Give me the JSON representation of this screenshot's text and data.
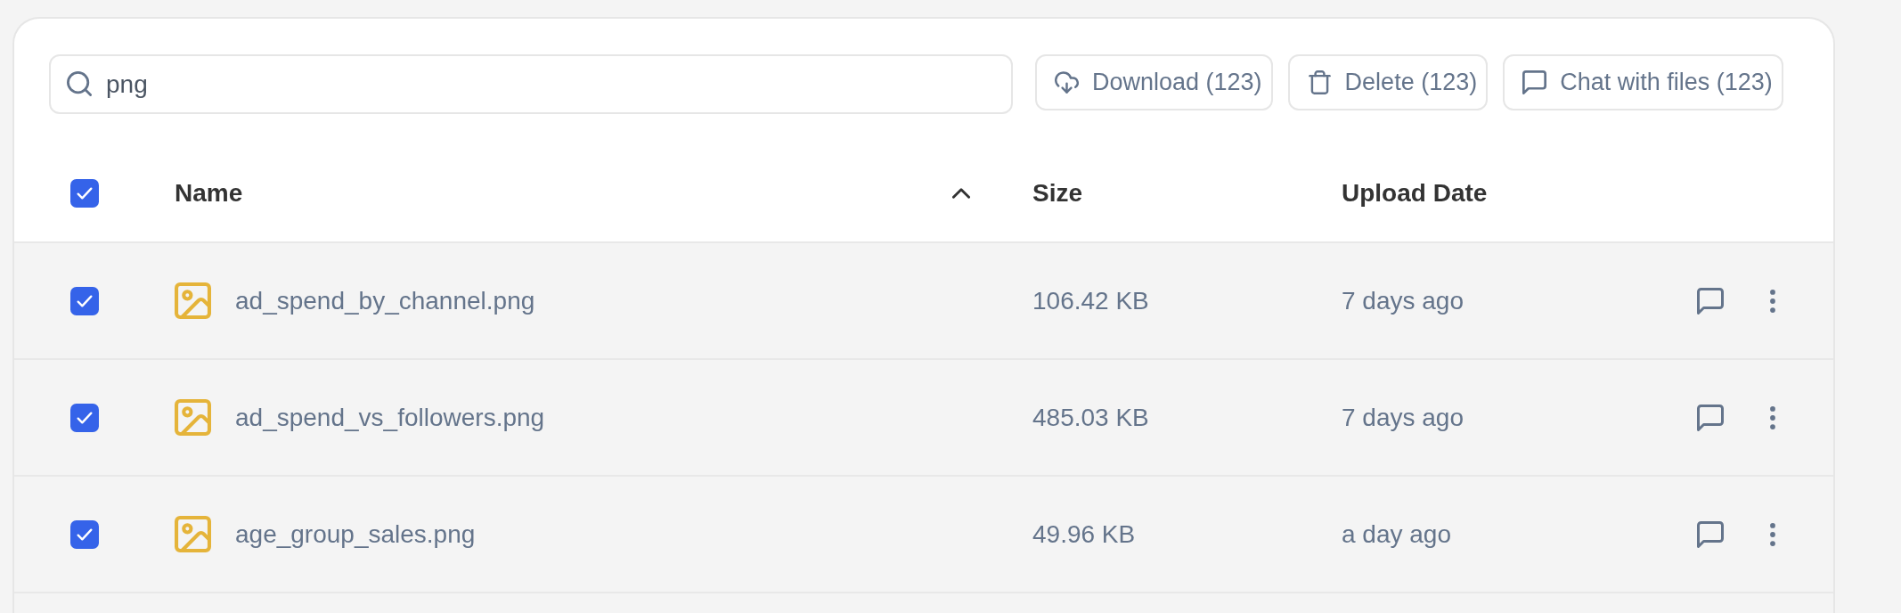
{
  "search": {
    "value": "png"
  },
  "actions": [
    {
      "kind": "download",
      "label": "Download (123)"
    },
    {
      "kind": "delete",
      "label": "Delete (123)"
    },
    {
      "kind": "chat",
      "label": "Chat with files (123)"
    }
  ],
  "table": {
    "select_all": {
      "checked": true
    },
    "columns": [
      {
        "label": "Name",
        "sorted": true
      },
      {
        "label": "Size",
        "sorted": false
      },
      {
        "label": "Upload Date",
        "sorted": false
      }
    ],
    "rows": [
      {
        "checked": true,
        "name": "ad_spend_by_channel.png",
        "size": "106.42 KB",
        "upload_date": "7 days ago"
      },
      {
        "checked": true,
        "name": "ad_spend_vs_followers.png",
        "size": "485.03 KB",
        "upload_date": "7 days ago"
      },
      {
        "checked": true,
        "name": "age_group_sales.png",
        "size": "49.96 KB",
        "upload_date": "a day ago"
      }
    ]
  }
}
